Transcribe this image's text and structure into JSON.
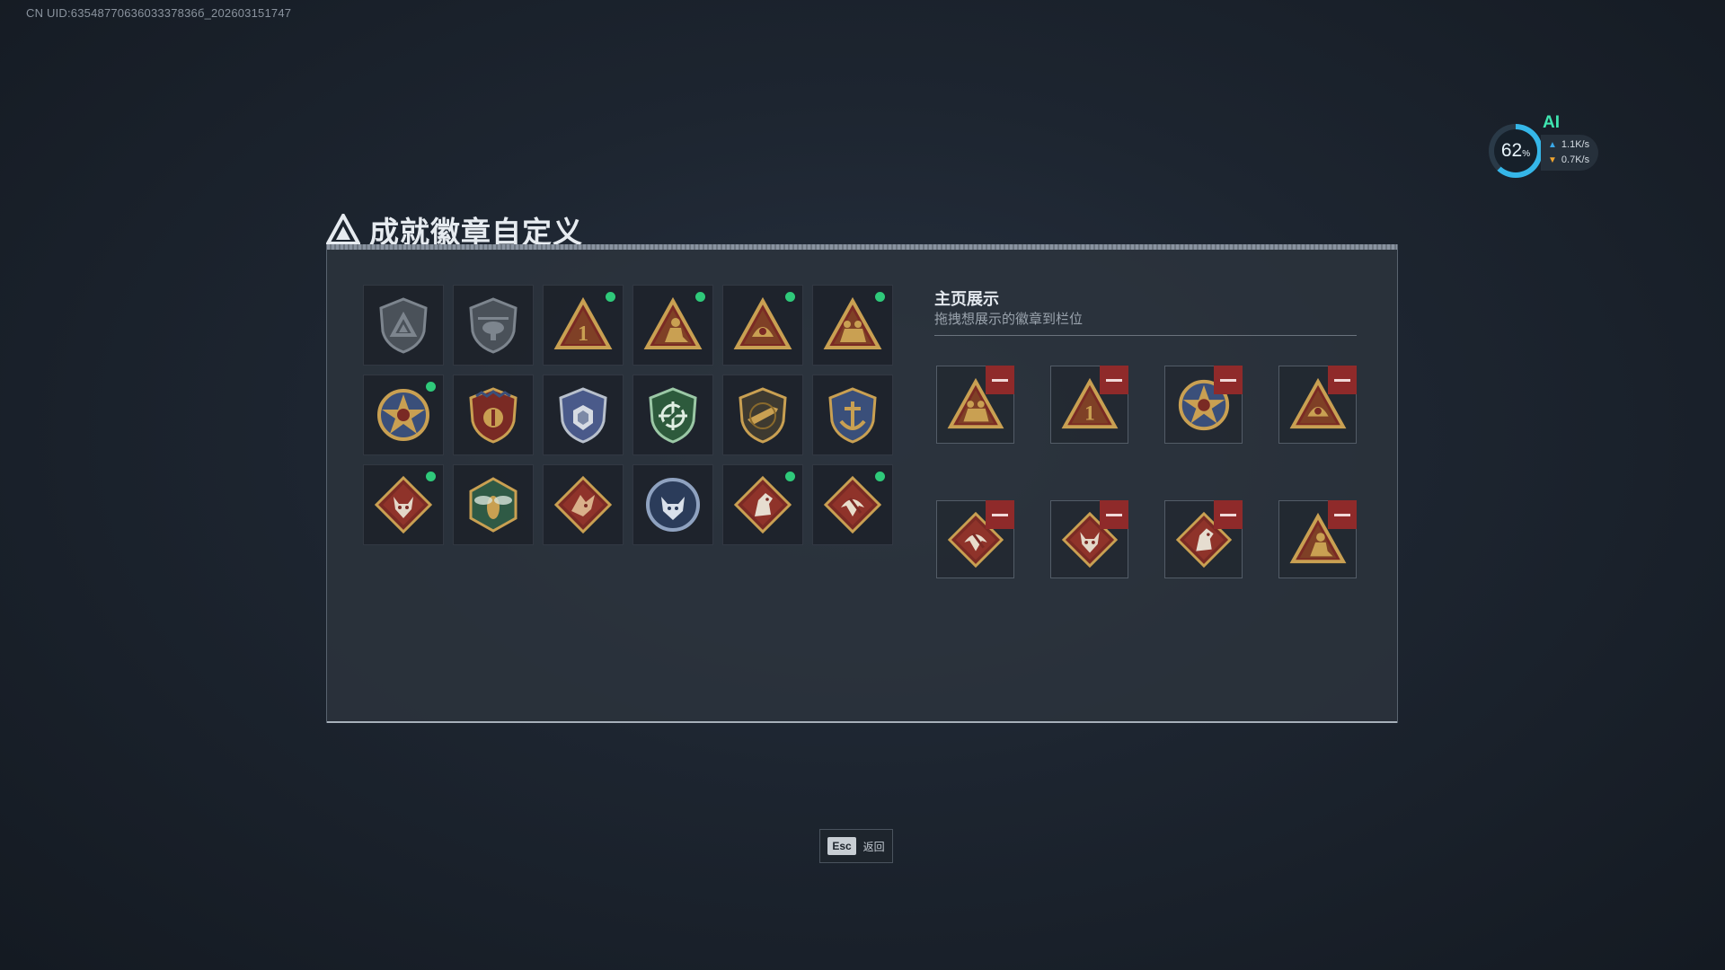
{
  "uid": "CN UID:6354877063603337836б_202603151747",
  "perf": {
    "ai_label": "AI",
    "percent": "62",
    "percent_unit": "%",
    "upload": "1.1K/s",
    "download": "0.7K/s",
    "ring_value": 0.62
  },
  "title": "成就徽章自定义",
  "showcase": {
    "title": "主页展示",
    "subtitle": "拖拽想展示的徽章到栏位"
  },
  "badges": [
    {
      "icon": "grey-shield-triangle-badge-icon",
      "new": false
    },
    {
      "icon": "grey-helicopter-shield-badge-icon",
      "new": false
    },
    {
      "icon": "gold-triangle-number-one-badge-icon",
      "new": true
    },
    {
      "icon": "gold-triangle-kneeling-soldier-badge-icon",
      "new": true
    },
    {
      "icon": "gold-triangle-helmet-badge-icon",
      "new": true
    },
    {
      "icon": "gold-triangle-soldiers-badge-icon",
      "new": true
    },
    {
      "icon": "star-medal-badge-icon",
      "new": true
    },
    {
      "icon": "eagle-crest-shield-badge-icon",
      "new": false
    },
    {
      "icon": "silver-armor-shield-badge-icon",
      "new": false
    },
    {
      "icon": "green-crosshair-shield-badge-icon",
      "new": false
    },
    {
      "icon": "rifle-shield-badge-icon",
      "new": false
    },
    {
      "icon": "anchor-navy-crest-badge-icon",
      "new": false
    },
    {
      "icon": "wolf-diamond-badge-icon",
      "new": true
    },
    {
      "icon": "wasp-hexagon-badge-icon",
      "new": false
    },
    {
      "icon": "dragon-diamond-badge-icon",
      "new": false
    },
    {
      "icon": "wolf-round-badge-icon",
      "new": false
    },
    {
      "icon": "horse-diamond-badge-icon",
      "new": true
    },
    {
      "icon": "eagle-diamond-badge-icon",
      "new": true
    }
  ],
  "slots": [
    {
      "icon": "gold-triangle-soldiers-badge-icon"
    },
    {
      "icon": "gold-triangle-number-one-badge-icon"
    },
    {
      "icon": "star-medal-badge-icon"
    },
    {
      "icon": "gold-triangle-helmet-badge-icon"
    },
    {
      "icon": "eagle-diamond-badge-icon"
    },
    {
      "icon": "wolf-diamond-badge-icon"
    },
    {
      "icon": "horse-diamond-badge-icon"
    },
    {
      "icon": "gold-triangle-kneeling-soldier-badge-icon"
    }
  ],
  "esc": {
    "key": "Esc",
    "label": "返回"
  }
}
